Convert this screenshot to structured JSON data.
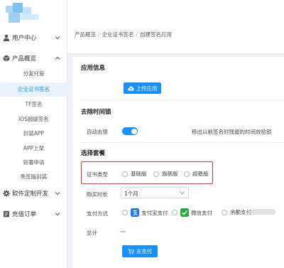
{
  "sidebar": {
    "groups": [
      {
        "label": "用户中心",
        "icon": "user-icon",
        "state": "collapsed"
      },
      {
        "label": "产品概览",
        "icon": "cube-icon",
        "state": "expanded"
      },
      {
        "label": "软件定制开发",
        "icon": "gear-icon",
        "state": "collapsed"
      },
      {
        "label": "充值订单",
        "icon": "order-icon",
        "state": "collapsed"
      }
    ],
    "items": [
      {
        "label": "分发托管"
      },
      {
        "label": "企业证书签名"
      },
      {
        "label": "TF签名"
      },
      {
        "label": "IOS超级签名"
      },
      {
        "label": "封装APP"
      },
      {
        "label": "APP上架"
      },
      {
        "label": "软著申请"
      },
      {
        "label": "免签版封装"
      }
    ],
    "active_item": "企业证书签名"
  },
  "breadcrumb": {
    "items": [
      "产品概览",
      "企业证书签名",
      "创建签名应用"
    ]
  },
  "form": {
    "app_info": {
      "title": "应用信息",
      "upload_label": "上传应用"
    },
    "time_lock": {
      "title": "去除时间锁",
      "auto_label": "自动去锁",
      "toggle_on": true,
      "hint": "移出以前签名时残留的时间效验锁"
    },
    "plan": {
      "title": "选择套餐",
      "cert_type_label": "证书类型",
      "cert_options": [
        "基础版",
        "旗舰版",
        "超稳版"
      ],
      "duration_label": "购买时长",
      "duration_value": "1个月",
      "payment_label": "支付方式",
      "payment_options": [
        {
          "label": "支付宝支付",
          "icon": "alipay-icon"
        },
        {
          "label": "微信支付",
          "icon": "wechat-pay-icon"
        },
        {
          "label": "余额支付",
          "icon": ""
        }
      ],
      "total_label": "总计",
      "total_value": "--",
      "pay_button": "去支付"
    }
  },
  "colors": {
    "primary": "#1890ff",
    "highlight_box": "#e03a3a",
    "alipay": "#1677ff",
    "wechat": "#22ac38"
  }
}
